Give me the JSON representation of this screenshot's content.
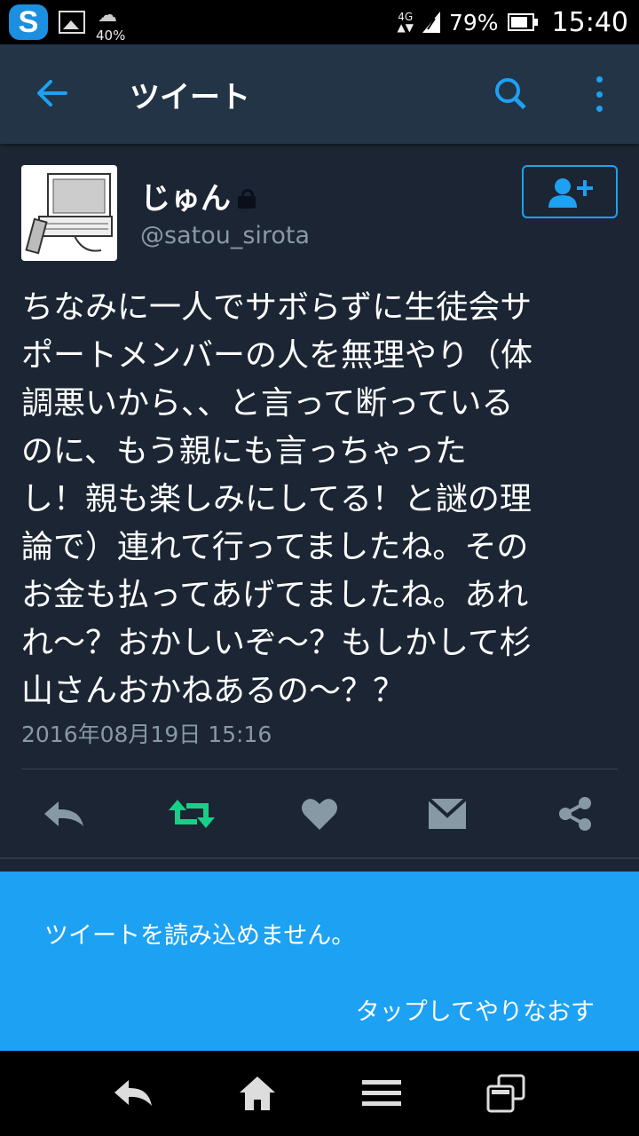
{
  "status_bar": {
    "weather_percent": "40%",
    "network": "4G",
    "battery_percent": "79%",
    "time": "15:40"
  },
  "app_bar": {
    "title": "ツイート",
    "accent": "#1da1f2"
  },
  "tweet": {
    "name": "じゅん",
    "handle": "@satou_sirota",
    "protected": true,
    "text": "ちなみに一人でサボらずに生徒会サ\nポートメンバーの人を無理やり（体\n調悪いから、、と言って断っている\nのに、もう親にも言っちゃった\nし！親も楽しみにしてる！と謎の理\n論で）連れて行ってましたね。その\nお金も払ってあげてましたね。あれ\nれ〜？おかしいぞ〜？もしかして杉\n山さんおかねあるの〜？？",
    "timestamp": "2016年08月19日 15:16",
    "actions": [
      "reply-icon",
      "retweet-icon",
      "like-icon",
      "message-icon",
      "share-icon"
    ],
    "retweet_color": "#19cf86"
  },
  "banner": {
    "message": "ツイートを読み込めません。",
    "retry": "タップしてやりなおす",
    "color": "#1da1f2"
  },
  "nav_bar": {
    "buttons": [
      "back-icon",
      "home-icon",
      "menu-icon",
      "recent-apps-icon"
    ]
  }
}
